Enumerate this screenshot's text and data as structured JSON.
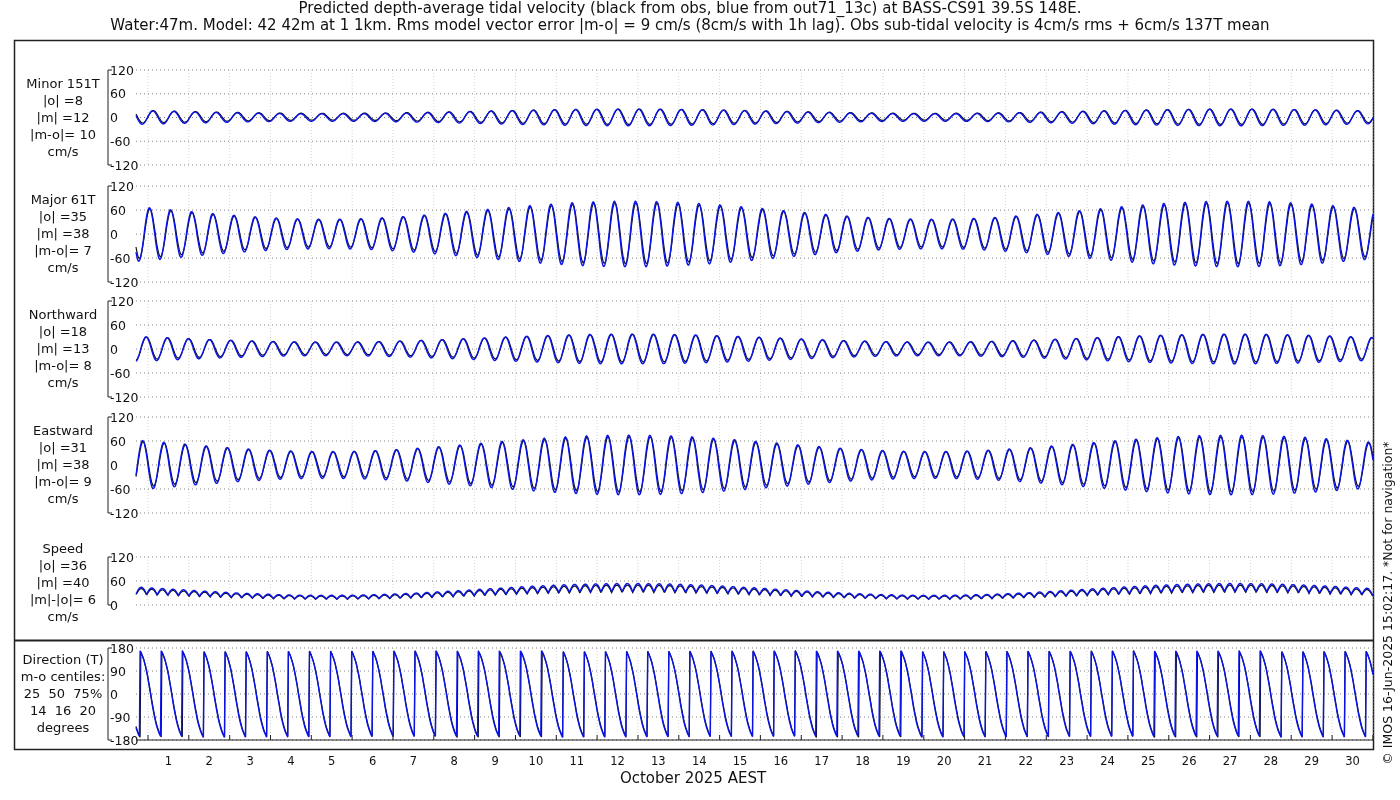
{
  "title_lines": [
    "Predicted depth-average tidal velocity (black from obs, blue from out71_13c) at BASS-CS91 39.5S 148E.",
    "Water:47m. Model: 42 42m at 1 1km. Rms model vector error |m-o| = 9 cm/s (8cm/s with 1h lag). Obs sub-tidal velocity is 4cm/s rms + 6cm/s 137T mean"
  ],
  "panels": [
    {
      "kind": "signed",
      "label_lines": [
        "Minor 151T",
        "|o| =8",
        "|m| =12",
        "|m-o|= 10",
        "cm/s"
      ],
      "yticks": [
        "120",
        "60",
        "0",
        "-60",
        "-120"
      ]
    },
    {
      "kind": "signed",
      "label_lines": [
        "Major 61T",
        "|o| =35",
        "|m| =38",
        "|m-o|= 7",
        "cm/s"
      ],
      "yticks": [
        "120",
        "60",
        "0",
        "-60",
        "-120"
      ]
    },
    {
      "kind": "signed",
      "label_lines": [
        "Northward",
        "|o| =18",
        "|m| =13",
        "|m-o|= 8",
        "cm/s"
      ],
      "yticks": [
        "120",
        "60",
        "0",
        "-60",
        "-120"
      ]
    },
    {
      "kind": "signed",
      "label_lines": [
        "Eastward",
        "|o| =31",
        "|m| =38",
        "|m-o|= 9",
        "cm/s"
      ],
      "yticks": [
        "120",
        "60",
        "0",
        "-60",
        "-120"
      ]
    },
    {
      "kind": "speed",
      "label_lines": [
        "Speed",
        "|o| =36",
        "|m| =40",
        "|m|-|o|= 6",
        "cm/s"
      ],
      "yticks": [
        "120",
        "60",
        "0"
      ]
    },
    {
      "kind": "direction",
      "label_lines": [
        "Direction (T)",
        "m-o centiles:",
        "25  50  75%",
        "14  16  20",
        "degrees"
      ],
      "yticks": [
        "180",
        "90",
        "0",
        "-90",
        "-180"
      ]
    }
  ],
  "x_ticks": [
    "1",
    "2",
    "3",
    "4",
    "5",
    "6",
    "7",
    "8",
    "9",
    "10",
    "11",
    "12",
    "13",
    "14",
    "15",
    "16",
    "17",
    "18",
    "19",
    "20",
    "21",
    "22",
    "23",
    "24",
    "25",
    "26",
    "27",
    "28",
    "29",
    "30"
  ],
  "xlabel": "October 2025 AEST",
  "credit": "© IMOS 16-Jun-2025 15:02:17. *Not for navigation*"
}
